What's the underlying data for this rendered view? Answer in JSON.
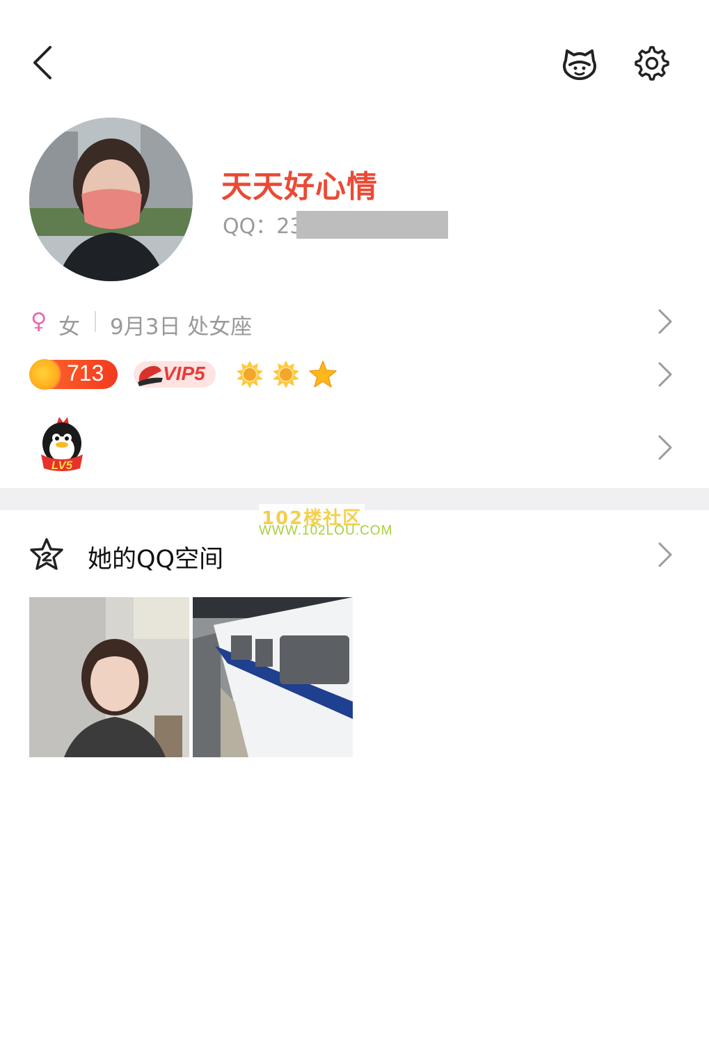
{
  "header": {
    "back_icon": "chevron-left-icon",
    "mascot_icon": "bear-mascot-icon",
    "settings_icon": "gear-icon"
  },
  "profile": {
    "nickname": "天天好心情",
    "qq_label": "QQ：23",
    "nickname_color": "#ea4a36"
  },
  "info": {
    "gender_symbol": "♀",
    "gender": "女",
    "birthday": "9月3日 处女座"
  },
  "badges": {
    "coins": "713",
    "vip": "VIP5",
    "level": "LV5"
  },
  "qzone": {
    "title": "她的QQ空间"
  },
  "watermark": {
    "line1": "102楼社区",
    "line2": "WWW.102LOU.COM"
  }
}
